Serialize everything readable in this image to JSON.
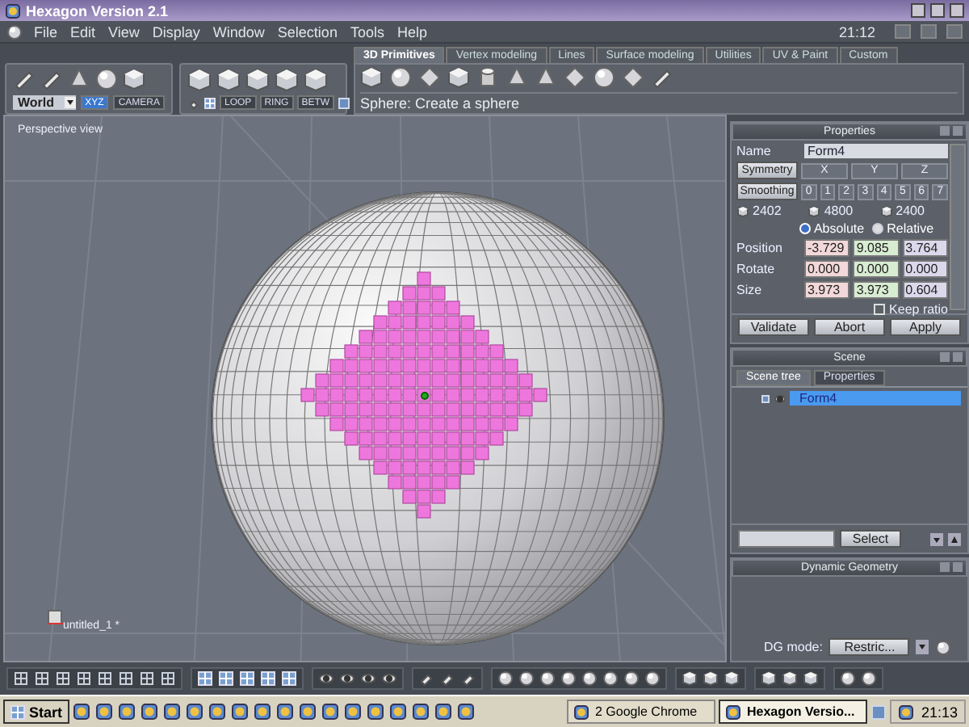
{
  "window": {
    "title": "Hexagon Version 2.1"
  },
  "menu": {
    "items": [
      "File",
      "Edit",
      "View",
      "Display",
      "Window",
      "Selection",
      "Tools",
      "Help"
    ],
    "clock": "21:12"
  },
  "toolbar": {
    "space_dropdown": "World",
    "space_buttons": [
      {
        "label": "XYZ",
        "selected": true
      },
      {
        "label": "CAMERA",
        "selected": false
      }
    ],
    "selection_buttons": [
      "LOOP",
      "RING",
      "BETW"
    ]
  },
  "tabs": [
    {
      "label": "3D Primitives",
      "selected": true
    },
    {
      "label": "Vertex modeling",
      "selected": false
    },
    {
      "label": "Lines",
      "selected": false
    },
    {
      "label": "Surface modeling",
      "selected": false
    },
    {
      "label": "Utilities",
      "selected": false
    },
    {
      "label": "UV & Paint",
      "selected": false
    },
    {
      "label": "Custom",
      "selected": false
    }
  ],
  "hint": "Sphere: Create a sphere",
  "viewport": {
    "label": "Perspective view",
    "object_label": "untitled_1 *"
  },
  "properties": {
    "title": "Properties",
    "name_label": "Name",
    "name_value": "Form4",
    "symmetry": "Symmetry",
    "axes": [
      "X",
      "Y",
      "Z"
    ],
    "smoothing": "Smoothing",
    "levels": [
      "0",
      "1",
      "2",
      "3",
      "4",
      "5",
      "6",
      "7"
    ],
    "counts": [
      "2402",
      "4800",
      "2400"
    ],
    "modes": [
      {
        "label": "Absolute",
        "selected": true
      },
      {
        "label": "Relative",
        "selected": false
      }
    ],
    "rows": [
      {
        "label": "Position",
        "values": [
          "-3.729",
          "9.085",
          "3.764"
        ]
      },
      {
        "label": "Rotate",
        "values": [
          "0.000",
          "0.000",
          "0.000"
        ]
      },
      {
        "label": "Size",
        "values": [
          "3.973",
          "3.973",
          "0.604"
        ]
      }
    ],
    "keep_ratio": {
      "label": "Keep ratio",
      "checked": false
    },
    "buttons": [
      "Validate",
      "Abort",
      "Apply"
    ]
  },
  "scene": {
    "title": "Scene",
    "tabs": [
      {
        "label": "Scene tree",
        "selected": true
      },
      {
        "label": "Properties",
        "selected": false
      }
    ],
    "tree": [
      {
        "label": "Form4",
        "selected": true
      }
    ],
    "select_button": "Select"
  },
  "dynamic_geometry": {
    "title": "Dynamic Geometry",
    "mode_label": "DG mode:",
    "mode_value": "Restric..."
  },
  "taskbar": {
    "start": "Start",
    "tasks": [
      {
        "label": "2 Google Chrome",
        "selected": false
      },
      {
        "label": "Hexagon Versio...",
        "selected": true
      }
    ],
    "clock": "21:13"
  }
}
